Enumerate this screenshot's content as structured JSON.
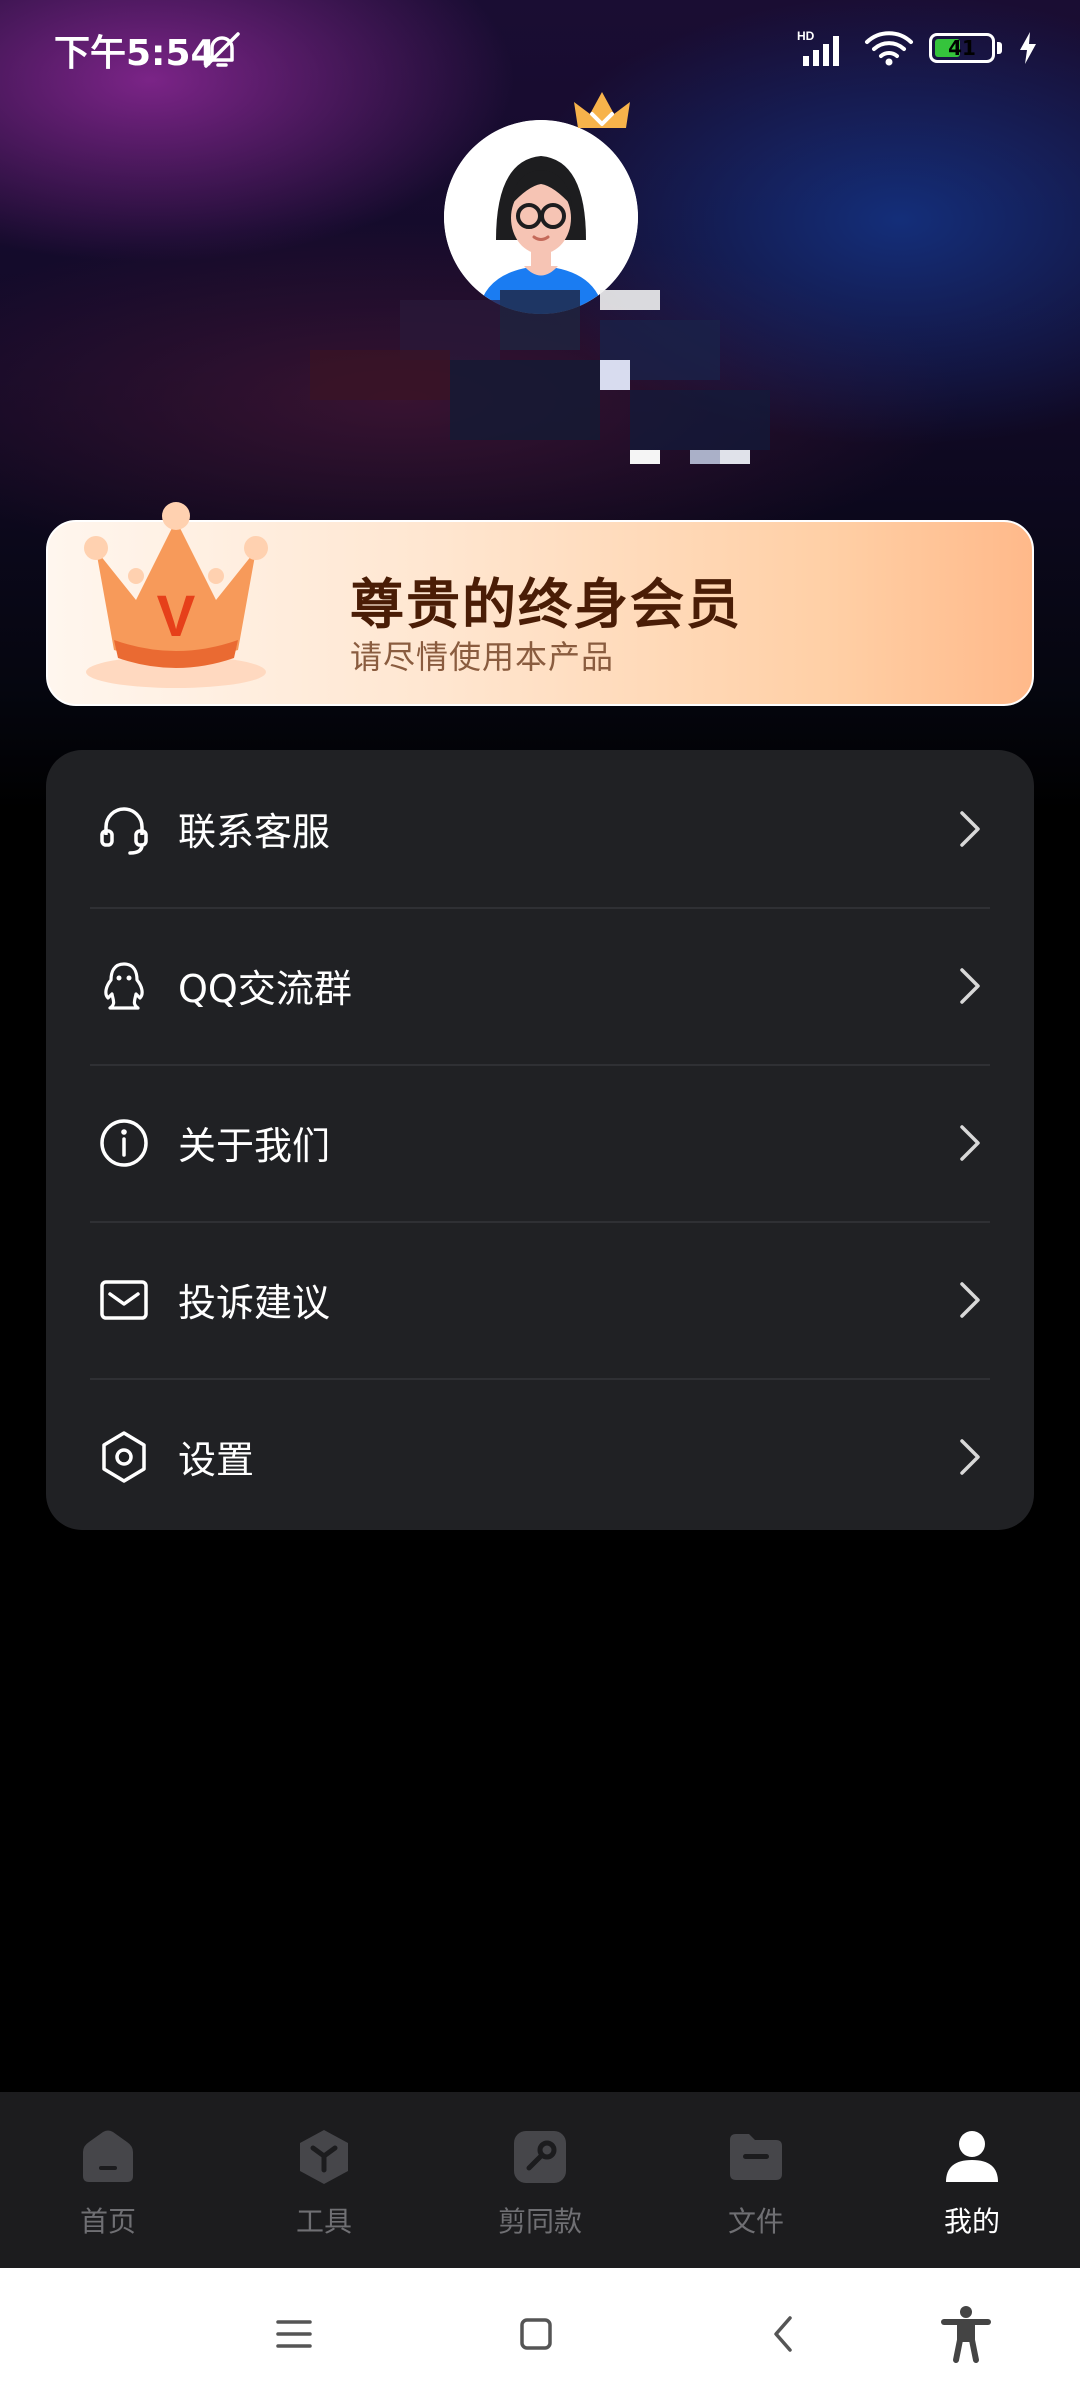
{
  "status_bar": {
    "time": "下午5:54",
    "signal_badge": "HD",
    "battery_level": "41",
    "icons": [
      "dnd-bell-off-icon",
      "signal-icon",
      "wifi-icon",
      "battery-icon",
      "charging-bolt-icon"
    ]
  },
  "profile": {
    "avatar_icon": "avatar-girl-icon",
    "badge_icon": "crown-badge-icon"
  },
  "vip_banner": {
    "title": "尊贵的终身会员",
    "subtitle": "请尽情使用本产品",
    "crown_letter": "V"
  },
  "menu": {
    "items": [
      {
        "label": "联系客服",
        "icon": "headset-icon"
      },
      {
        "label": "QQ交流群",
        "icon": "qq-penguin-icon"
      },
      {
        "label": "关于我们",
        "icon": "info-icon"
      },
      {
        "label": "投诉建议",
        "icon": "mail-icon"
      },
      {
        "label": "设置",
        "icon": "settings-icon"
      }
    ]
  },
  "bottom_nav": {
    "items": [
      {
        "label": "首页",
        "icon": "home-icon",
        "active": false
      },
      {
        "label": "工具",
        "icon": "tools-icon",
        "active": false
      },
      {
        "label": "剪同款",
        "icon": "template-icon",
        "active": false
      },
      {
        "label": "文件",
        "icon": "folder-icon",
        "active": false
      },
      {
        "label": "我的",
        "icon": "profile-icon",
        "active": true
      }
    ]
  },
  "system_nav": {
    "buttons": [
      "menu-lines-icon",
      "home-square-icon",
      "back-icon",
      "accessibility-icon"
    ]
  },
  "colors": {
    "accent_vip": "#ffcfa5",
    "card_bg": "#202124",
    "active_nav": "#ffffff",
    "inactive_nav": "#6f6f73"
  }
}
